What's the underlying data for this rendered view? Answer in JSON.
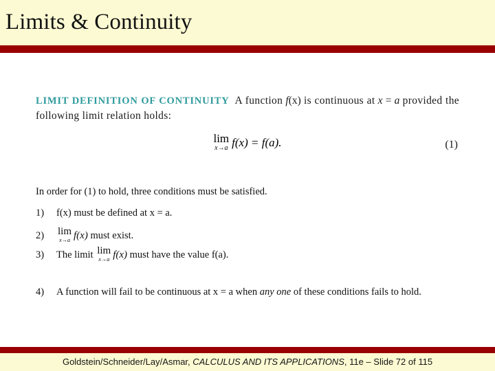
{
  "slide": {
    "title": "Limits & Continuity",
    "colors": {
      "header_background": "#fcfad2",
      "accent_rule": "#990000",
      "definition_heading": "#2f9a9c",
      "body_text": "#101010",
      "slide_background": "#ffffff"
    }
  },
  "definition": {
    "heading": "LIMIT DEFINITION OF CONTINUITY",
    "sentence_part_1": "A function",
    "function_notation": "f",
    "function_arg": "(x)",
    "sentence_part_2": "is continuous at",
    "point_var": "x",
    "point_equals": " = ",
    "point_value": "a",
    "sentence_part_3": "provided the following limit relation holds:",
    "equation": {
      "limit_operator": "lim",
      "limit_subscript": "x→a",
      "expression": "f(x) = f(a).",
      "number": "(1)"
    }
  },
  "body": {
    "intro": "In order for (1) to hold, three conditions must be satisfied.",
    "items": [
      {
        "marker": "1)",
        "text_before": "",
        "math": null,
        "text_after": "f(x) must be defined at x = a."
      },
      {
        "marker": "2)",
        "text_before": "",
        "math": {
          "limit_operator": "lim",
          "limit_subscript": "x→a",
          "expression": "f(x)"
        },
        "text_after": "must exist."
      },
      {
        "marker": "3)",
        "text_before": "The limit",
        "math": {
          "limit_operator": "lim",
          "limit_subscript": "x→a",
          "expression": "f(x)"
        },
        "text_after": "must have the value f(a)."
      },
      {
        "marker": "4)",
        "text_before": "A function will fail to be continuous at x = a when",
        "emphasis": "any one",
        "text_after": "of these conditions fails to hold."
      }
    ]
  },
  "footer": {
    "authors": "Goldstein/Schneider/Lay/Asmar,",
    "book_title": "CALCULUS AND ITS APPLICATIONS",
    "edition_and_slide": ", 11e – Slide 72 of 115"
  }
}
